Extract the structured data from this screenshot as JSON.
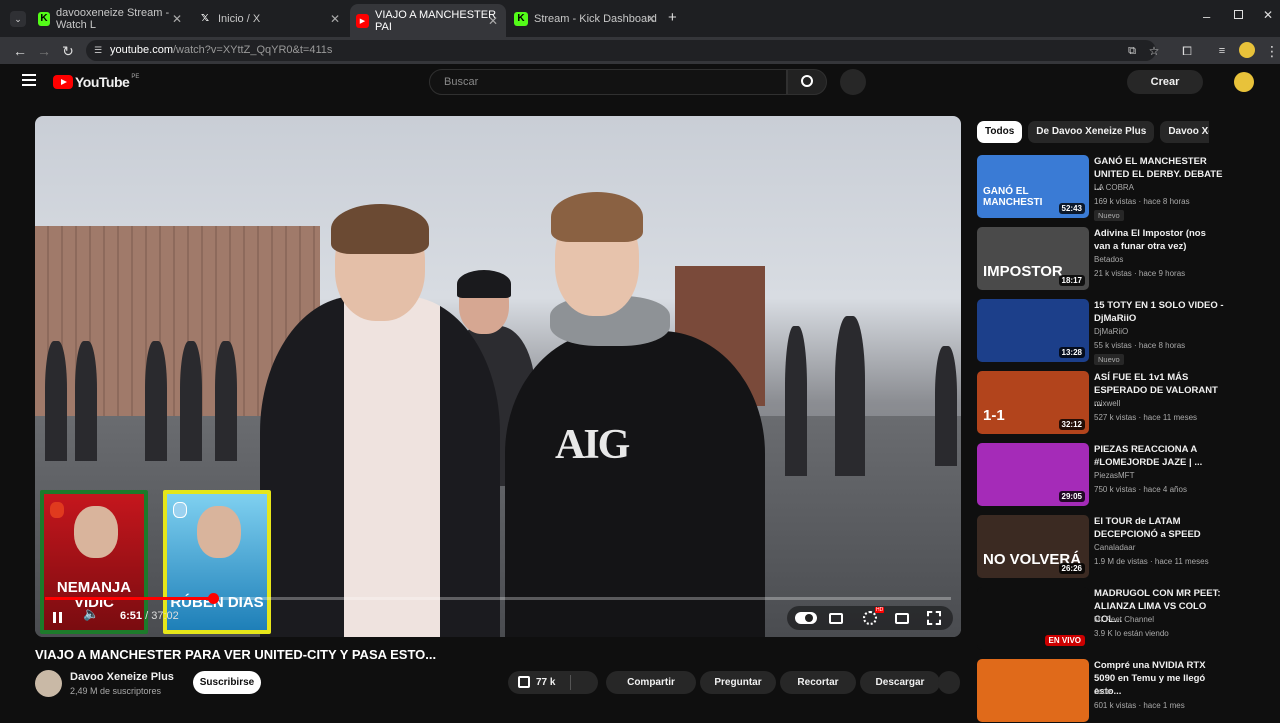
{
  "browser": {
    "tabs": [
      {
        "title": "davooxeneize Stream - Watch L",
        "favicon": "kick-icon",
        "color": "#53fc18"
      },
      {
        "title": "Inicio / X",
        "favicon": "x-icon",
        "color": "#ffffff"
      },
      {
        "title": "VIAJO A MANCHESTER PAI",
        "favicon": "youtube-icon",
        "color": "#ff0000"
      },
      {
        "title": "Stream - Kick Dashboard",
        "favicon": "kick-icon",
        "color": "#53fc18"
      }
    ],
    "url_host": "youtube.com",
    "url_rest": "/watch?v=XYttZ_QqYR0&t=411s"
  },
  "youtube": {
    "logo_text": "YouTube",
    "region": "PE",
    "search_placeholder": "Buscar",
    "create_label": "Crear"
  },
  "player": {
    "current_time": "6:51",
    "duration": "37:02",
    "progress_fraction": 0.185,
    "cards": [
      {
        "name_line1": "NEMANJA",
        "name_line2": "VIDIC"
      },
      {
        "name_line1": "RÚBEN DIAS",
        "name_line2": ""
      }
    ],
    "shirt_text": "AIG"
  },
  "video": {
    "title": "VIAJO A MANCHESTER PARA VER UNITED-CITY Y PASA ESTO...",
    "channel": "Davoo Xeneize Plus",
    "subscribers": "2,49 M de suscriptores",
    "subscribe_label": "Suscribirse",
    "likes": "77 k",
    "actions": [
      "Compartir",
      "Preguntar",
      "Recortar",
      "Descargar"
    ]
  },
  "sidebar": {
    "chips": [
      "Todos",
      "De Davoo Xeneize Plus",
      "Davoo Xeneize"
    ],
    "recommendations": [
      {
        "title": "GANÓ EL MANCHESTER UNITED EL DERBY. DEBATE ...",
        "channel": "LA COBRA",
        "meta": "169 k vistas · hace 8 horas",
        "badge": "Nuevo",
        "duration": "52:43",
        "thumb_text": "GANÓ EL MANCHESTI",
        "thumb_color": "#3a7bd5"
      },
      {
        "title": "Adivina El Impostor (nos van a funar otra vez)",
        "channel": "Betados",
        "meta": "21 k vistas · hace 9 horas",
        "badge": "",
        "duration": "18:17",
        "thumb_text": "IMPOSTOR",
        "thumb_color": "#4a4a4a"
      },
      {
        "title": "15 TOTY EN 1 SOLO VIDEO - DjMaRiiO",
        "channel": "DjMaRiiO",
        "meta": "55 k vistas · hace 8 horas",
        "badge": "Nuevo",
        "duration": "13:28",
        "thumb_text": "",
        "thumb_color": "#1c3f8a"
      },
      {
        "title": "ASÍ FUE EL 1v1 MÁS ESPERADO DE VALORANT ...",
        "channel": "mixwell",
        "meta": "527 k vistas · hace 11 meses",
        "badge": "",
        "duration": "32:12",
        "thumb_text": "1-1",
        "thumb_color": "#b2441c"
      },
      {
        "title": "PIEZAS REACCIONA A #LOMEJORDE JAZE | ...",
        "channel": "PiezasMFT",
        "meta": "750 k vistas · hace 4 años",
        "badge": "",
        "duration": "29:05",
        "thumb_text": "",
        "thumb_color": "#a52bb8"
      },
      {
        "title": "El TOUR de LATAM DECEPCIONÓ a SPEED",
        "channel": "Canaladaar",
        "meta": "1.9 M de vistas · hace 11 meses",
        "badge": "",
        "duration": "26:26",
        "thumb_text": "NO VOLVERÁ",
        "thumb_color": "#3b2a22"
      },
      {
        "title": "MADRUGOL CON MR PEET: ALIANZA LIMA VS COLO COL...",
        "channel": "Mr Peet Channel",
        "meta": "3.9 K lo están viendo",
        "badge": "",
        "duration": "",
        "live": "EN VIVO",
        "thumb_text": "",
        "thumb_color": "#0f0f0f"
      },
      {
        "title": "Compré una NVIDIA RTX 5090 en Temu y me llegó esto...",
        "channel": "Jade",
        "meta": "601 k vistas · hace 1 mes",
        "badge": "",
        "duration": "",
        "thumb_text": "",
        "thumb_color": "#e06a1a"
      }
    ]
  }
}
